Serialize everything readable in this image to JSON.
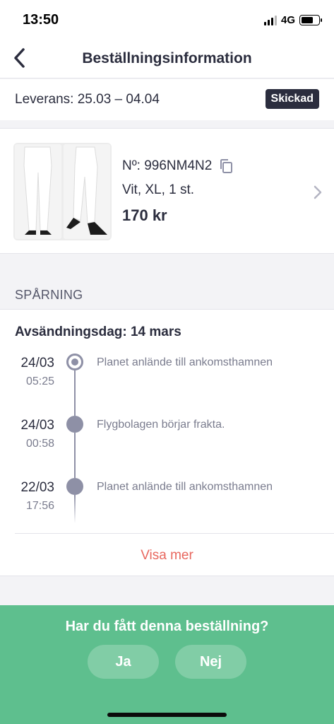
{
  "status_bar": {
    "time": "13:50",
    "network": "4G",
    "battery_level": 0.7
  },
  "nav": {
    "title": "Beställningsinformation",
    "back_icon": "chevron-left-icon"
  },
  "delivery": {
    "text": "Leverans: 25.03 – 04.04",
    "status_badge": "Skickad"
  },
  "product": {
    "order_number": "Nº: 996NM4N2",
    "copy_icon": "copy-icon",
    "variant": "Vit, XL, 1 st.",
    "price": "170 kr",
    "chevron_icon": "chevron-right-icon"
  },
  "tracking": {
    "title": "SPÅRNING",
    "dispatch": "Avsändningsdag: 14 mars",
    "events": [
      {
        "date": "24/03",
        "time": "05:25",
        "text": "Planet anlände till ankomsthamnen",
        "current": true
      },
      {
        "date": "24/03",
        "time": "00:58",
        "text": "Flygbolagen börjar frakta.",
        "current": false
      },
      {
        "date": "22/03",
        "time": "17:56",
        "text": "Planet anlände till ankomsthamnen",
        "current": false
      }
    ],
    "show_more": "Visa mer"
  },
  "confirmation": {
    "question": "Har du fått denna beställning?",
    "yes": "Ja",
    "no": "Nej"
  },
  "colors": {
    "accent_green": "#5ebf8e",
    "link_red": "#e8675e",
    "badge_dark": "#2b2d3e"
  }
}
